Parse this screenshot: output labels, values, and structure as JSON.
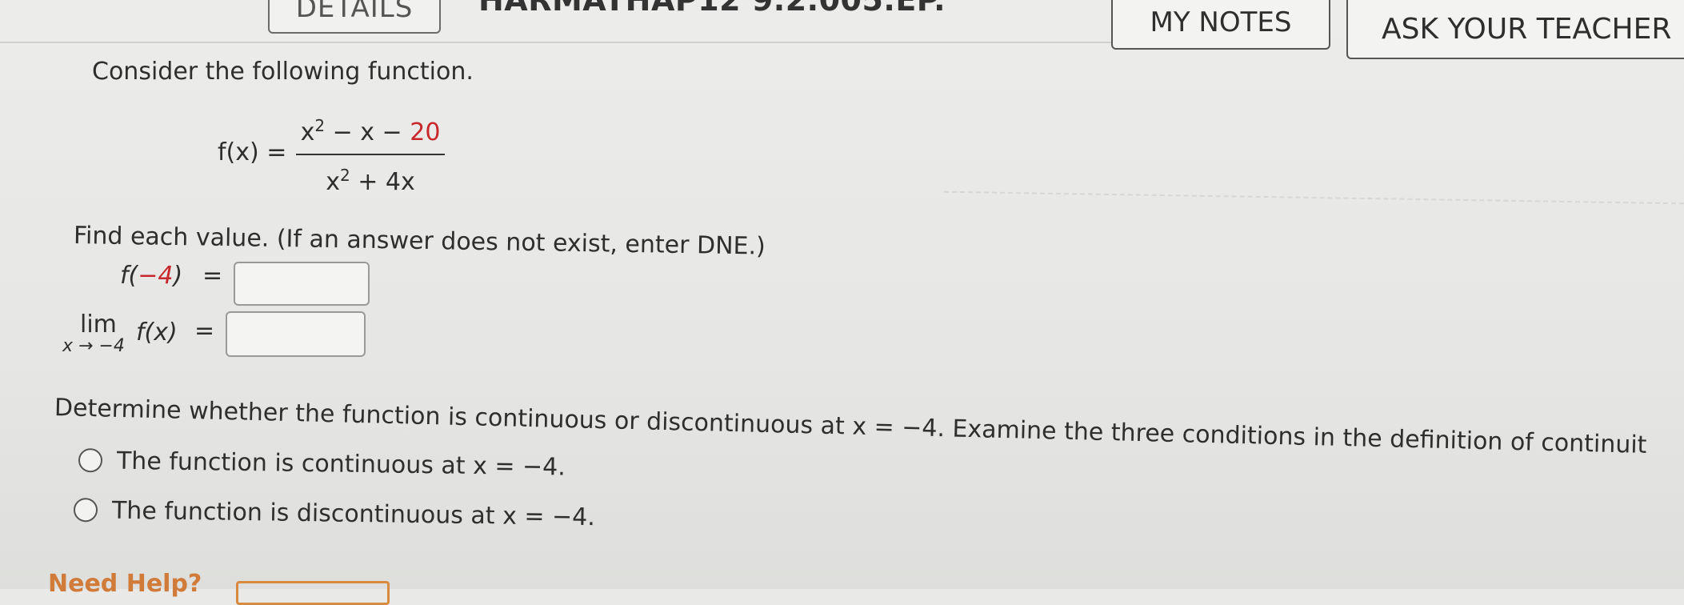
{
  "header": {
    "details_label": "DETAILS",
    "problem_id": "HARMATHAP12 9.2.005.EP.",
    "my_notes_label": "MY NOTES",
    "ask_teacher_label": "ASK YOUR TEACHER"
  },
  "problem": {
    "prompt": "Consider the following function.",
    "function_label": "f(x) =",
    "numerator_x": "x",
    "numerator_exp": "2",
    "numerator_rest": " − x − ",
    "numerator_const": "20",
    "denominator_x": "x",
    "denominator_exp": "2",
    "denominator_rest": " + 4x",
    "instructions": "Find each value. (If an answer does not exist, enter DNE.)"
  },
  "parts": {
    "value_label_prefix": "f(",
    "value_label_arg": "−4",
    "value_label_suffix": ")",
    "equals": "=",
    "value_answer": "",
    "limit_word": "lim",
    "limit_subscript": "x → −4",
    "limit_function": "f(x)",
    "limit_answer": ""
  },
  "continuity": {
    "question": "Determine whether the function is continuous or discontinuous at x = −4. Examine the three conditions in the definition of continuit",
    "options": [
      {
        "label": "The function is continuous at x = −4.",
        "selected": false
      },
      {
        "label": "The function is discontinuous at x = −4.",
        "selected": false
      }
    ]
  },
  "footer": {
    "need_help": "Need Help?"
  },
  "colors": {
    "highlight_red": "#c8282b",
    "help_orange": "#d07b3a"
  }
}
